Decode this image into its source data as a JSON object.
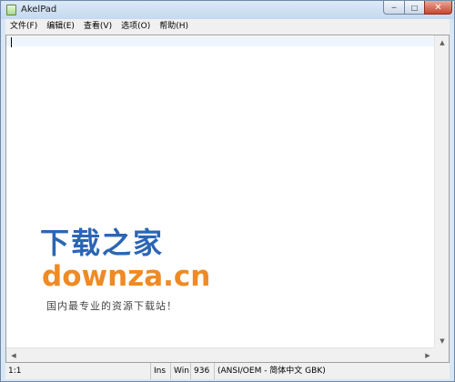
{
  "window": {
    "title": "AkelPad",
    "controls": {
      "minimize": "─",
      "maximize": "□",
      "close": "✕"
    }
  },
  "menu": [
    "文件(F)",
    "编辑(E)",
    "查看(V)",
    "选项(O)",
    "帮助(H)"
  ],
  "editor": {
    "content": ""
  },
  "scrollbars": {
    "up": "▲",
    "down": "▼",
    "left": "◀",
    "right": "▶"
  },
  "status": {
    "position": "1:1",
    "insert_mode": "Ins",
    "newline": "Win",
    "codepage_number": "936",
    "codepage": "(ANSI/OEM - 简体中文 GBK)"
  },
  "watermark": {
    "title": "下载之家",
    "url": "downza.cn",
    "tagline": "国内最专业的资源下载站！",
    "colors": {
      "title": "#2b66b4",
      "url": "#ef8a24"
    }
  }
}
